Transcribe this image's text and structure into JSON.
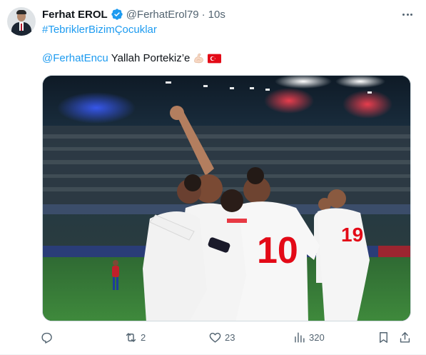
{
  "author": {
    "name": "Ferhat EROL",
    "handle": "@FerhatErol79",
    "separator": "·",
    "time": "10s",
    "avatar_icon": "avatar-man-suit"
  },
  "tweet": {
    "hashtag": "#TebriklerBizimÇocuklar",
    "mention": "@FerhatEncu",
    "text": "Yallah Portekiz’e",
    "emojis": [
      "flexed-biceps",
      "turkey-flag"
    ]
  },
  "media": {
    "description_icon": "photo-football-celebration",
    "jersey_numbers": [
      "10",
      "19"
    ]
  },
  "actions": {
    "reply": {
      "icon": "reply-icon",
      "count": ""
    },
    "retweet": {
      "icon": "retweet-icon",
      "count": "2"
    },
    "like": {
      "icon": "heart-icon",
      "count": "23"
    },
    "views": {
      "icon": "views-icon",
      "count": "320"
    },
    "bookmark": {
      "icon": "bookmark-icon"
    },
    "share": {
      "icon": "share-icon"
    }
  },
  "colors": {
    "link": "#1d9bf0",
    "secondary_text": "#536471",
    "primary_text": "#0f1419",
    "verified_badge": "#1d9bf0",
    "flag_red": "#e30a17"
  }
}
